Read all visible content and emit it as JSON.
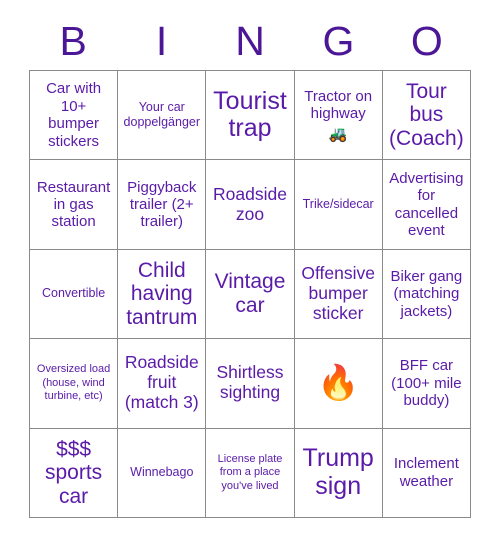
{
  "card": {
    "title": "BINGO",
    "header_letters": [
      "B",
      "I",
      "N",
      "G",
      "O"
    ],
    "accent_color": "#4B1796",
    "cell_text_color": "#5A1BA8",
    "border_color": "#8a8a8a",
    "background_color": "#ffffff",
    "grid_size": "5x5"
  },
  "cells": [
    {
      "id": "b1",
      "column": "B",
      "row": 1,
      "text": "Car with 10+ bumper stickers",
      "size": "md",
      "emoji": ""
    },
    {
      "id": "i1",
      "column": "I",
      "row": 1,
      "text": "Your car doppelgänger",
      "size": "sm",
      "emoji": ""
    },
    {
      "id": "n1",
      "column": "N",
      "row": 1,
      "text": "Tourist trap",
      "size": "xxl",
      "emoji": ""
    },
    {
      "id": "g1",
      "column": "G",
      "row": 1,
      "text": "Tractor on highway",
      "size": "md",
      "emoji": "🚜"
    },
    {
      "id": "o1",
      "column": "O",
      "row": 1,
      "text": "Tour bus (Coach)",
      "size": "xl",
      "emoji": ""
    },
    {
      "id": "b2",
      "column": "B",
      "row": 2,
      "text": "Restaurant in gas station",
      "size": "md",
      "emoji": ""
    },
    {
      "id": "i2",
      "column": "I",
      "row": 2,
      "text": "Piggyback trailer (2+ trailer)",
      "size": "md",
      "emoji": ""
    },
    {
      "id": "n2",
      "column": "N",
      "row": 2,
      "text": "Roadside zoo",
      "size": "lg",
      "emoji": ""
    },
    {
      "id": "g2",
      "column": "G",
      "row": 2,
      "text": "Trike/sidecar",
      "size": "sm",
      "emoji": ""
    },
    {
      "id": "o2",
      "column": "O",
      "row": 2,
      "text": "Advertising for cancelled event",
      "size": "md",
      "emoji": ""
    },
    {
      "id": "b3",
      "column": "B",
      "row": 3,
      "text": "Convertible",
      "size": "sm",
      "emoji": ""
    },
    {
      "id": "i3",
      "column": "I",
      "row": 3,
      "text": "Child having tantrum",
      "size": "xl",
      "emoji": ""
    },
    {
      "id": "n3",
      "column": "N",
      "row": 3,
      "text": "Vintage car",
      "size": "xl",
      "emoji": ""
    },
    {
      "id": "g3",
      "column": "G",
      "row": 3,
      "text": "Offensive bumper sticker",
      "size": "lg",
      "emoji": ""
    },
    {
      "id": "o3",
      "column": "O",
      "row": 3,
      "text": "Biker gang (matching jackets)",
      "size": "md",
      "emoji": ""
    },
    {
      "id": "b4",
      "column": "B",
      "row": 4,
      "text": "Oversized load (house, wind turbine, etc)",
      "size": "xs",
      "emoji": ""
    },
    {
      "id": "i4",
      "column": "I",
      "row": 4,
      "text": "Roadside fruit (match 3)",
      "size": "lg",
      "emoji": ""
    },
    {
      "id": "n4",
      "column": "N",
      "row": 4,
      "text": "Shirtless sighting",
      "size": "lg",
      "emoji": ""
    },
    {
      "id": "g4",
      "column": "G",
      "row": 4,
      "text": "",
      "size": "md",
      "emoji": "🔥"
    },
    {
      "id": "o4",
      "column": "O",
      "row": 4,
      "text": "BFF car (100+ mile buddy)",
      "size": "md",
      "emoji": ""
    },
    {
      "id": "b5",
      "column": "B",
      "row": 5,
      "text": "$$$ sports car",
      "size": "xl",
      "emoji": ""
    },
    {
      "id": "i5",
      "column": "I",
      "row": 5,
      "text": "Winnebago",
      "size": "sm",
      "emoji": ""
    },
    {
      "id": "n5",
      "column": "N",
      "row": 5,
      "text": "License plate from a place you've lived",
      "size": "xs",
      "emoji": ""
    },
    {
      "id": "g5",
      "column": "G",
      "row": 5,
      "text": "Trump sign",
      "size": "xxl",
      "emoji": ""
    },
    {
      "id": "o5",
      "column": "O",
      "row": 5,
      "text": "Inclement weather",
      "size": "md",
      "emoji": ""
    }
  ]
}
